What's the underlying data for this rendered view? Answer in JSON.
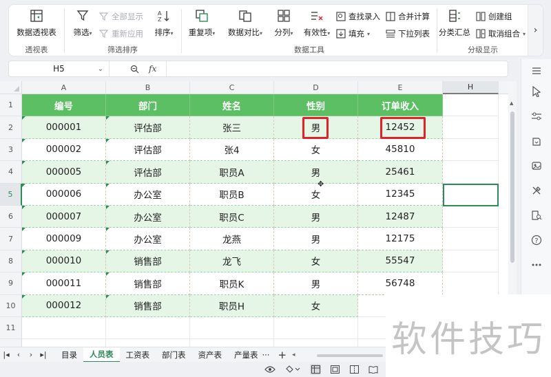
{
  "ribbon": {
    "pivot": {
      "label": "数据透视表",
      "group": "透视表"
    },
    "filter": {
      "label": "筛选",
      "show_all": "全部显示",
      "reapply": "重新应用",
      "sort": "排序",
      "group": "筛选排序"
    },
    "data_tools": {
      "duplicates": "重复项",
      "compare": "数据对比",
      "split": "分列",
      "validation": "有效性",
      "find_entry": "查找录入",
      "fill": "填充",
      "merge_calc": "合并计算",
      "dropdown": "下拉列表",
      "group": "数据工具"
    },
    "outline": {
      "subtotal": "分类汇总",
      "create_group": "创建组",
      "ungroup": "取消组合",
      "group": "分级显示"
    }
  },
  "formula_bar": {
    "cell_ref": "H5",
    "fx": "fx",
    "formula": ""
  },
  "columns": [
    "A",
    "B",
    "C",
    "D",
    "E",
    "H"
  ],
  "rows": [
    "1",
    "2",
    "3",
    "4",
    "5",
    "6",
    "7",
    "8",
    "9",
    "10",
    "11",
    "12"
  ],
  "table": {
    "headers": [
      "编号",
      "部门",
      "姓名",
      "性别",
      "订单收入"
    ],
    "rows": [
      [
        "000001",
        "评估部",
        "张三",
        "男",
        "12452"
      ],
      [
        "000002",
        "评估部",
        "张4",
        "女",
        "45810"
      ],
      [
        "000005",
        "评估部",
        "职员A",
        "男",
        "25461"
      ],
      [
        "000006",
        "办公室",
        "职员B",
        "女",
        "12345"
      ],
      [
        "000007",
        "办公室",
        "职员C",
        "男",
        "12487"
      ],
      [
        "000009",
        "办公室",
        "龙燕",
        "男",
        "12175"
      ],
      [
        "000010",
        "销售部",
        "龙飞",
        "女",
        "55547"
      ],
      [
        "000011",
        "销售部",
        "职员K",
        "男",
        "56748"
      ],
      [
        "000012",
        "销售部",
        "职员H",
        "女",
        ""
      ]
    ]
  },
  "sheet_tabs": {
    "tabs": [
      "目录",
      "人员表",
      "工资表",
      "部门表",
      "资产表",
      "产量表"
    ],
    "active": "人员表",
    "more": "···",
    "add": "+"
  },
  "watermark": "软件技巧",
  "colors": {
    "header_green": "#5cbf63",
    "band_green": "#e5f5e6",
    "accent": "#2e8b57",
    "highlight_red": "#e0202a"
  }
}
